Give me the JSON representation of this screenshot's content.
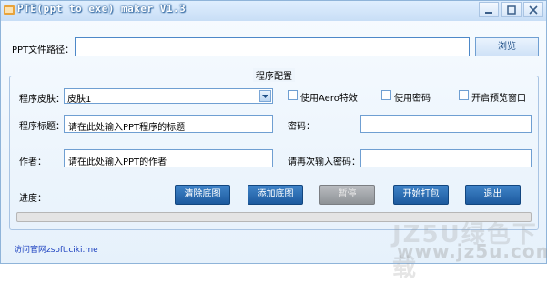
{
  "window": {
    "title": "PTE(ppt to exe) maker V1.3",
    "controls": [
      "minimize",
      "maximize",
      "close"
    ],
    "title_color": "#ffffff"
  },
  "path_row": {
    "label": "PPT文件路径：",
    "value": "",
    "browse_label": "浏览"
  },
  "group": {
    "title": "程序配置"
  },
  "skin": {
    "label": "程序皮肤：",
    "value": "皮肤1"
  },
  "options": [
    {
      "label": "使用Aero特效",
      "checked": false
    },
    {
      "label": "使用密码",
      "checked": false
    },
    {
      "label": "开启预览窗口",
      "checked": false
    }
  ],
  "program_title": {
    "label": "程序标题：",
    "value": "请在此处输入PPT程序的标题"
  },
  "password": {
    "label": "密码：",
    "value": ""
  },
  "author": {
    "label": "作者：",
    "value": "请在此处输入PPT的作者"
  },
  "password_confirm": {
    "label": "请再次输入密码：",
    "value": ""
  },
  "progress": {
    "label": "进度：",
    "value_fraction": 0
  },
  "buttons": {
    "clear_bg": "清除底图",
    "add_bg": "添加底图",
    "pause": "暂停",
    "start_pack": "开始打包",
    "exit": "退出"
  },
  "footer": {
    "site_link": "访问官网zsoft.ciki.me"
  },
  "watermark": {
    "line1": "JZ5U绿色下载",
    "line2": "www.jz5u.com"
  },
  "colors": {
    "button_blue": "#2a6db3",
    "button_disabled": "#a3a6aa",
    "border_blue": "#6f9fd2"
  }
}
